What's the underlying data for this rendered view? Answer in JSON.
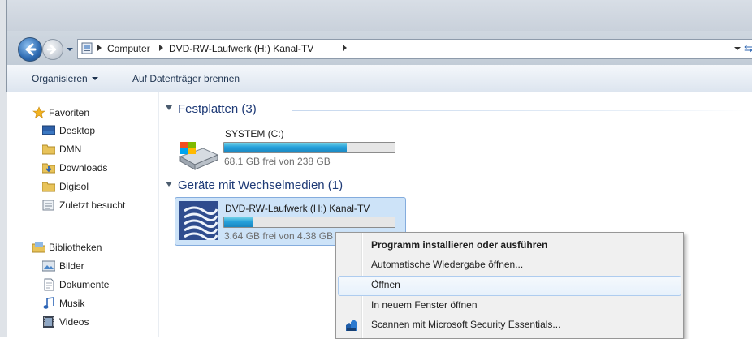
{
  "address": {
    "crumbs": [
      "Computer",
      "DVD-RW-Laufwerk (H:) Kanal-TV"
    ]
  },
  "commandbar": {
    "organize": "Organisieren",
    "burn": "Auf Datenträger brennen"
  },
  "navpane": {
    "favorites_header": "Favoriten",
    "favorites": [
      "Desktop",
      "DMN",
      "Downloads",
      "Digisol",
      "Zuletzt besucht"
    ],
    "libraries_header": "Bibliotheken",
    "libraries": [
      "Bilder",
      "Dokumente",
      "Musik",
      "Videos"
    ]
  },
  "groups": {
    "harddisks": "Festplatten (3)",
    "removable": "Geräte mit Wechselmedien (1)"
  },
  "drives": {
    "system": {
      "name": "SYSTEM (C:)",
      "free": "68.1 GB frei von 238 GB",
      "used_fraction": 0.72
    },
    "dvd": {
      "name": "DVD-RW-Laufwerk (H:) Kanal-TV",
      "free": "3.64 GB frei von 4.38 GB",
      "used_fraction": 0.17
    }
  },
  "context_menu": {
    "items": [
      "Programm installieren oder ausführen",
      "Automatische Wiedergabe öffnen...",
      "Öffnen",
      "In neuem Fenster öffnen",
      "Scannen mit Microsoft Security Essentials..."
    ]
  },
  "colors": {
    "accent": "#26a0da",
    "group_header": "#1e3a76"
  }
}
